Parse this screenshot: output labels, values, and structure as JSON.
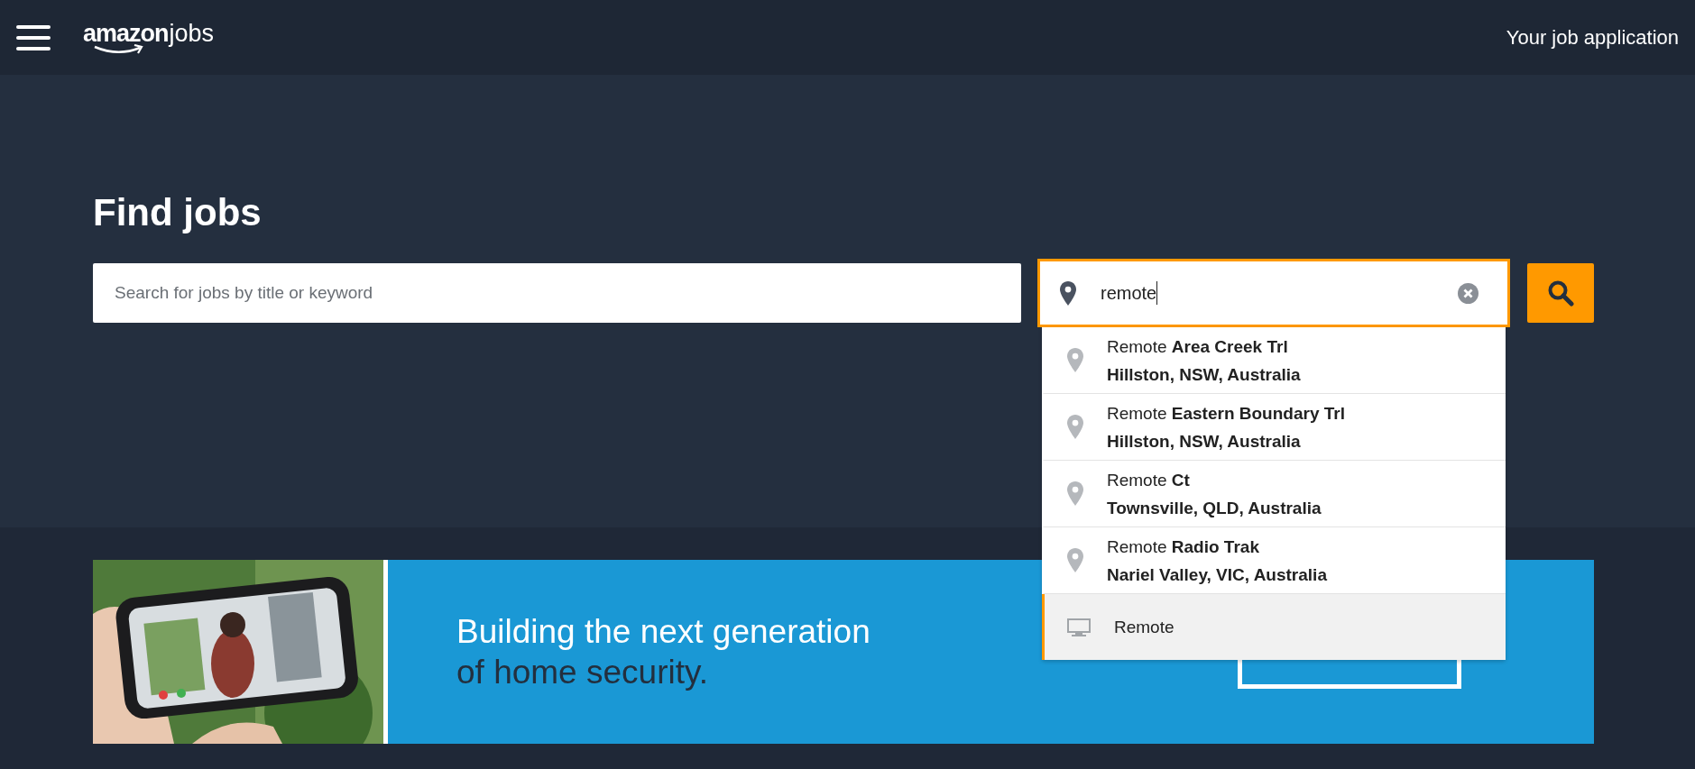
{
  "header": {
    "logo": {
      "brand": "amazon",
      "product": "jobs"
    },
    "link": "Your job application"
  },
  "hero": {
    "title": "Find jobs",
    "keyword_search": {
      "placeholder": "Search for jobs by title or keyword"
    },
    "location_search": {
      "value": "remote",
      "focused": true
    },
    "suggestions": [
      {
        "kind": "place",
        "text": "Remote **Area Creek Trl**",
        "detail": "Hillston, NSW, Australia",
        "selected": false
      },
      {
        "kind": "place",
        "text": "Remote **Eastern Boundary Trl**",
        "detail": "Hillston, NSW, Australia",
        "selected": false
      },
      {
        "kind": "place",
        "text": "Remote **Ct**",
        "detail": "Townsville, QLD, Australia",
        "selected": false
      },
      {
        "kind": "place",
        "text": "Remote **Radio Trak**",
        "detail": "Nariel Valley, VIC, Australia",
        "selected": false
      },
      {
        "kind": "remote",
        "text": "Remote",
        "selected": true
      }
    ]
  },
  "banner": {
    "headline": [
      {
        "text": "Building the next generation",
        "color": "#ffffff"
      },
      {
        "text": "of home security.",
        "color": "#232f3e"
      }
    ]
  }
}
